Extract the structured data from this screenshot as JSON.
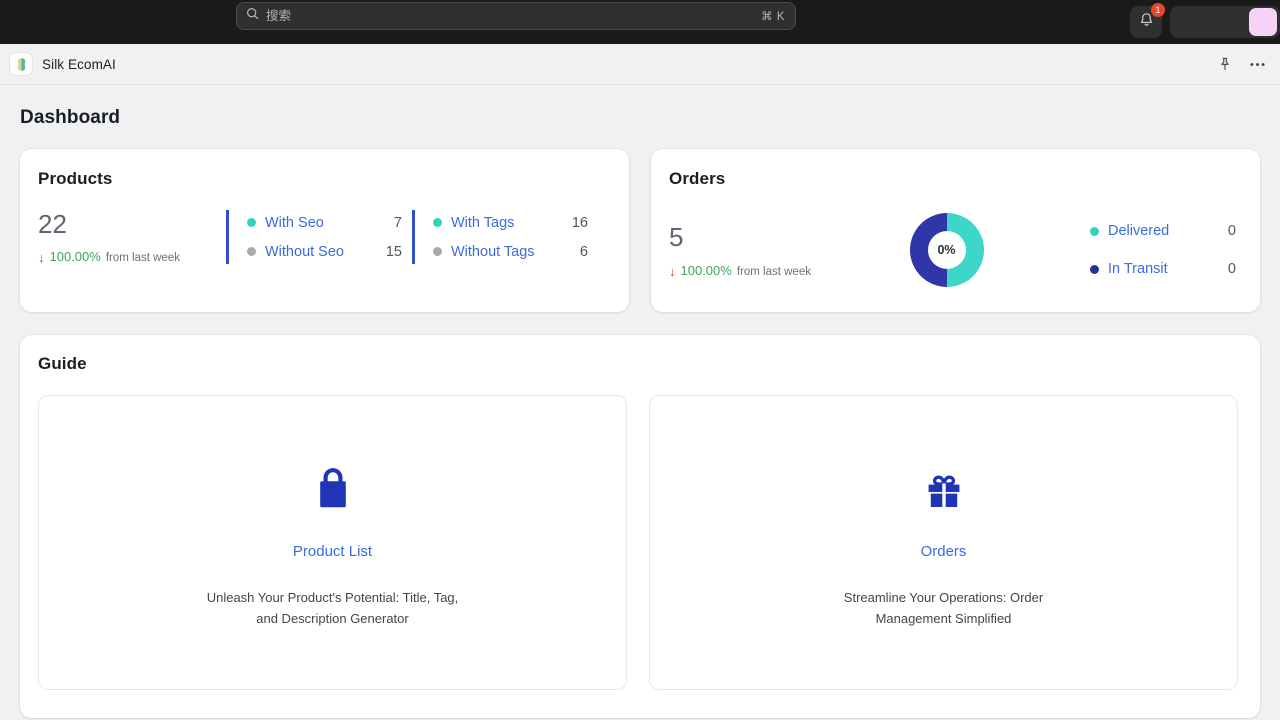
{
  "topbar": {
    "search": {
      "placeholder": "搜索",
      "shortcut": "⌘ K",
      "icon": "search-icon"
    },
    "notifications": {
      "icon": "bell-icon",
      "badge_count": "1"
    },
    "avatar": {
      "icon": "avatar",
      "color": "#f5d3f5"
    }
  },
  "appbar": {
    "title": "Silk EcomAI",
    "logo_icon": "app-logo-icon",
    "actions": [
      {
        "icon": "pin-icon"
      },
      {
        "icon": "ellipsis-icon"
      }
    ]
  },
  "page": {
    "title": "Dashboard"
  },
  "products": {
    "heading": "Products",
    "total": "22",
    "delta_arrow": "↓",
    "delta_percent": "100.00%",
    "delta_note": "from last week",
    "delta_color": "#3da45c",
    "arrow_color": "#e0301e",
    "seo": [
      {
        "label": "With Seo",
        "count": "7",
        "dot": "teal"
      },
      {
        "label": "Without Seo",
        "count": "15",
        "dot": "gray"
      }
    ],
    "tags": [
      {
        "label": "With Tags",
        "count": "16",
        "dot": "teal"
      },
      {
        "label": "Without Tags",
        "count": "6",
        "dot": "gray"
      }
    ]
  },
  "orders": {
    "heading": "Orders",
    "total": "5",
    "delta_arrow": "↓",
    "delta_percent": "100.00%",
    "delta_note": "from last week",
    "donut_center_label": "0%",
    "legend": [
      {
        "label": "Delivered",
        "count": "0",
        "dot": "teal"
      },
      {
        "label": "In Transit",
        "count": "0",
        "dot": "navy"
      }
    ]
  },
  "chart_data": {
    "type": "pie",
    "title": "Orders",
    "center_label": "0%",
    "categories": [
      "In Transit",
      "Delivered"
    ],
    "values": [
      50,
      50
    ],
    "colors": [
      "#2f37a8",
      "#3ed6c8"
    ],
    "legend_position": "right",
    "legend_values": [
      {
        "name": "Delivered",
        "value": 0,
        "color": "#2ed3be"
      },
      {
        "name": "In Transit",
        "value": 0,
        "color": "#22339c"
      }
    ],
    "total": 5,
    "donut": true
  },
  "guide": {
    "heading": "Guide",
    "tiles": [
      {
        "icon": "shopping-bag-icon",
        "link": "Product List",
        "desc": "Unleash Your Product's Potential: Title, Tag, and Description Generator"
      },
      {
        "icon": "gift-icon",
        "link": "Orders",
        "desc": "Streamline Your Operations: Order Management Simplified"
      }
    ]
  },
  "colors": {
    "accent_blue": "#3b6ae1",
    "divider_blue": "#2f4fd0",
    "teal": "#2ed3be",
    "navy": "#22339c",
    "icon_blue": "#1f35b5",
    "page_bg": "#f0f1f3"
  }
}
